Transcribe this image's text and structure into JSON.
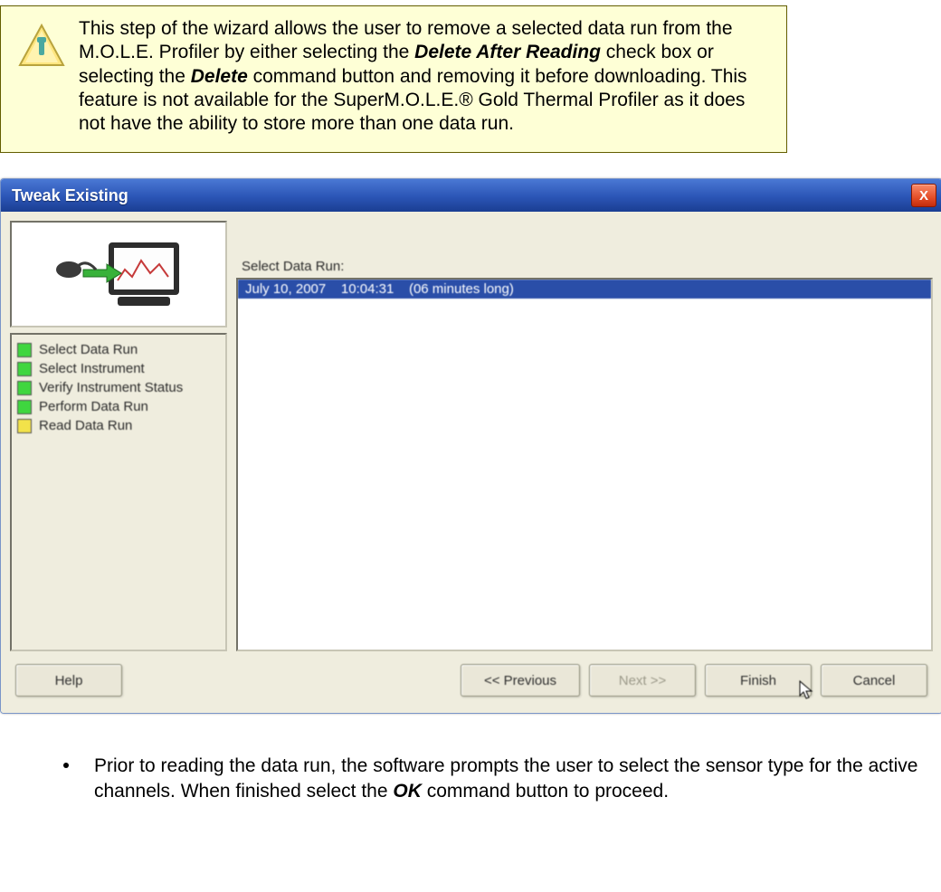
{
  "info": {
    "text_a": "This step of the wizard allows the user to remove a selected data run from the M.O.L.E. Profiler by either selecting the ",
    "bold_a": "Delete After Reading",
    "text_b": " check box or selecting the ",
    "bold_b": "Delete",
    "text_c": " command button and removing it before downloading. This feature is not available for the SuperM.O.L.E.® Gold Thermal Profiler as it does not have the ability to store more than one data run."
  },
  "dialog": {
    "title": "Tweak Existing",
    "close": "X",
    "steps": [
      {
        "label": "Select Data Run",
        "state": "green"
      },
      {
        "label": "Select Instrument",
        "state": "green"
      },
      {
        "label": "Verify Instrument Status",
        "state": "green"
      },
      {
        "label": "Perform Data Run",
        "state": "green"
      },
      {
        "label": "Read Data Run",
        "state": "yellow"
      }
    ],
    "list_label": "Select Data Run:",
    "list_items": [
      "July 10, 2007    10:04:31    (06 minutes long)"
    ],
    "buttons": {
      "help": "Help",
      "prev": "<< Previous",
      "next": "Next >>",
      "finish": "Finish",
      "cancel": "Cancel"
    }
  },
  "bullet": {
    "text_a": "Prior to reading the data run, the software prompts the user to select the sensor type for the active channels. When finished select the ",
    "bold_a": "OK",
    "text_b": " command button to proceed."
  }
}
